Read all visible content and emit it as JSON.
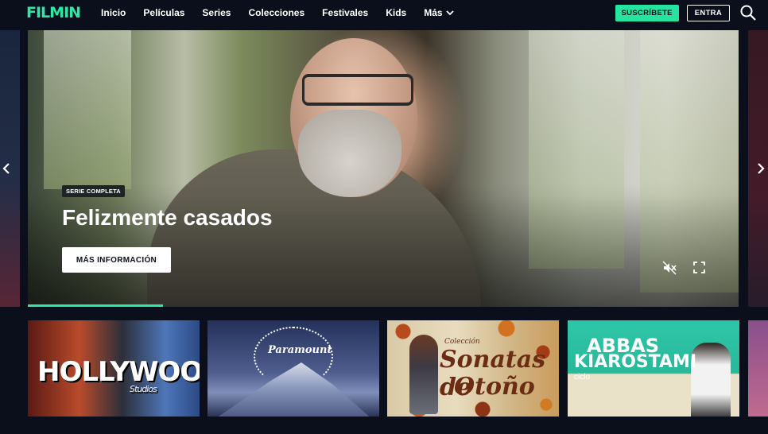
{
  "nav": {
    "logo": "FILMIN",
    "links": [
      "Inicio",
      "Películas",
      "Series",
      "Colecciones",
      "Festivales",
      "Kids"
    ],
    "more_label": "Más",
    "subscribe_label": "SUSCRÍBETE",
    "login_label": "ENTRA"
  },
  "hero": {
    "badge": "SERIE COMPLETA",
    "title": "Felizmente casados",
    "info_button": "MÁS INFORMACIÓN",
    "progress": 0.19
  },
  "row": {
    "cards": [
      {
        "title": "HOLLYWOOD",
        "subtitle": "Studios"
      },
      {
        "title": "Paramount"
      },
      {
        "pretitle": "Colección",
        "title_line1": "Sonatas de",
        "title_line2": "Otoño"
      },
      {
        "title_line1": "ABBAS",
        "title_line2": "KIAROSTAMI",
        "title_line3": "ciclo"
      }
    ]
  },
  "colors": {
    "accent": "#2ee6a6",
    "background": "#0b0f1c"
  },
  "icons": {
    "more": "chevron-down-icon",
    "search": "search-icon",
    "mute": "mute-icon",
    "fullscreen": "fullscreen-icon",
    "prev": "chevron-left-icon",
    "next": "chevron-right-icon"
  }
}
